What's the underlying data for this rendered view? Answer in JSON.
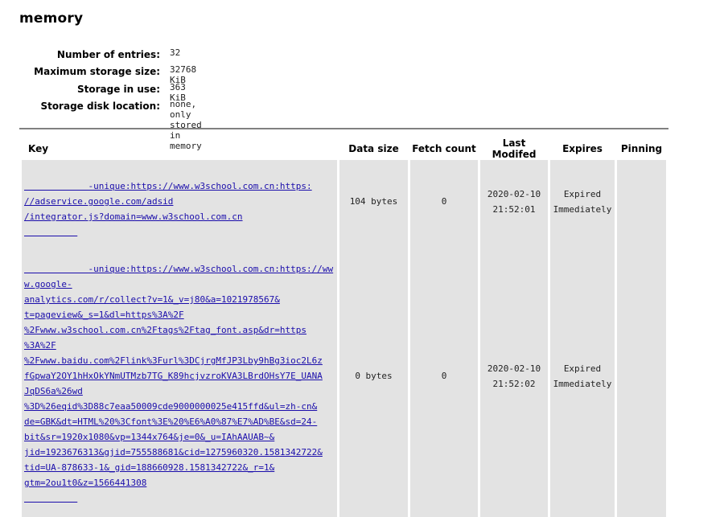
{
  "title": "memory",
  "summary": [
    {
      "label": "Number of entries:",
      "value": "32"
    },
    {
      "label": "Maximum storage size:",
      "value": "32768 KiB"
    },
    {
      "label": "Storage in use:",
      "value": "363 KiB"
    },
    {
      "label": "Storage disk location:",
      "value": "none, only stored in memory"
    }
  ],
  "table": {
    "headers": {
      "key": "Key",
      "data_size": "Data size",
      "fetch_count": "Fetch count",
      "last_modified": "Last Modifed",
      "expires": "Expires",
      "pinning": "Pinning"
    },
    "rows": [
      {
        "key_lines": [
          "-unique:https://www.w3school.com.cn:https:",
          "//adservice.google.com/adsid",
          "/integrator.js?domain=www.w3school.com.cn"
        ],
        "data_size": "104 bytes",
        "fetch_count": "0",
        "last_modified_date": "2020-02-10",
        "last_modified_time": "21:52:01",
        "expires_line1": "Expired",
        "expires_line2": "Immediately",
        "pinning": ""
      },
      {
        "key_lines": [
          "-unique:https://www.w3school.com.cn:https://www.google-",
          "analytics.com/r/collect?v=1&_v=j80&a=1021978567&",
          "t=pageview&_s=1&dl=https%3A%2F",
          "%2Fwww.w3school.com.cn%2Ftags%2Ftag_font.asp&dr=https",
          "%3A%2F",
          "%2Fwww.baidu.com%2Flink%3Furl%3DCjrgMfJP3Lby9hBg3ioc2L6z",
          "fGpwaY2OY1hHxOkYNmUTMzb7TG_K89hcjvzroKVA3LBrdOHsY7E_UANA",
          "JqDS6a%26wd",
          "%3D%26eqid%3D88c7eaa50009cde9000000025e415ffd&ul=zh-cn&",
          "de=GBK&dt=HTML%20%3Cfont%3E%20%E6%A0%87%E7%AD%BE&sd=24-",
          "bit&sr=1920x1080&vp=1344x764&je=0&_u=IAhAAUAB~&",
          "jid=1923676313&gjid=755588681&cid=1275960320.1581342722&",
          "tid=UA-878633-1&_gid=188660928.1581342722&_r=1&",
          "gtm=2ou1t0&z=1566441308"
        ],
        "data_size": "0 bytes",
        "fetch_count": "0",
        "last_modified_date": "2020-02-10",
        "last_modified_time": "21:52:02",
        "expires_line1": "Expired",
        "expires_line2": "Immediately",
        "pinning": ""
      }
    ]
  }
}
